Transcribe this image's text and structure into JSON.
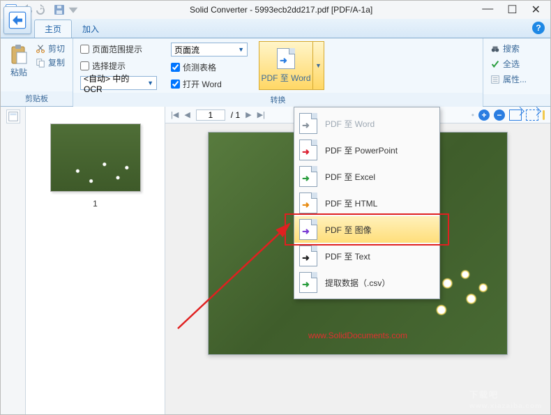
{
  "titlebar": {
    "title": "Solid Converter - 5993ecb2dd217.pdf [PDF/A-1a]"
  },
  "tabs": {
    "home": "主页",
    "add": "加入"
  },
  "ribbon": {
    "clipboard": {
      "title": "剪贴板",
      "paste": "粘贴",
      "cut": "剪切",
      "copy": "复制"
    },
    "convert": {
      "title": "转换",
      "page_range_hint": "页面范围提示",
      "selection_hint": "选择提示",
      "ocr_combo": "<自动> 中的 OCR",
      "layout_combo": "页面流",
      "detect_tables": "侦测表格",
      "open_word": "打开 Word",
      "pdf_to_word": "PDF 至 Word"
    },
    "utils": {
      "search": "搜索",
      "select_all": "全选",
      "properties": "属性..."
    }
  },
  "menu": {
    "items": [
      {
        "label": "PDF 至 Word",
        "disabled": true,
        "colorClass": "gray"
      },
      {
        "label": "PDF 至 PowerPoint",
        "disabled": false,
        "colorClass": "red"
      },
      {
        "label": "PDF 至 Excel",
        "disabled": false,
        "colorClass": "green"
      },
      {
        "label": "PDF 至 HTML",
        "disabled": false,
        "colorClass": "orange"
      },
      {
        "label": "PDF 至 图像",
        "disabled": false,
        "colorClass": "purple",
        "highlight": true
      },
      {
        "label": "PDF 至 Text",
        "disabled": false,
        "colorClass": "black"
      },
      {
        "label": "提取数据（.csv）",
        "disabled": false,
        "colorClass": "green"
      }
    ]
  },
  "pager": {
    "current": "1",
    "sep": "/ 1"
  },
  "thumb": {
    "num": "1"
  },
  "watermark": {
    "url": "www.SolidDocuments.com",
    "site": "下载吧",
    "site_en": "www.xiazaiba.com"
  }
}
